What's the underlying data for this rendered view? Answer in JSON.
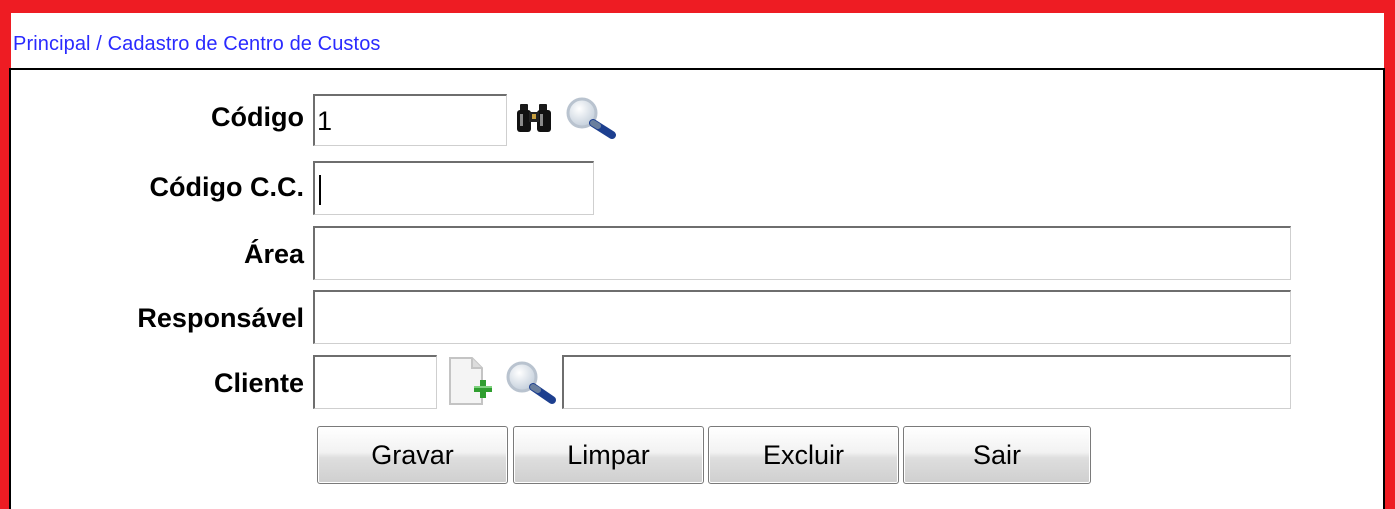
{
  "breadcrumb": "Principal / Cadastro de Centro de Custos",
  "form": {
    "codigo": {
      "label": "Código",
      "value": "1"
    },
    "codigo_cc": {
      "label": "Código C.C.",
      "value": ""
    },
    "area": {
      "label": "Área",
      "value": ""
    },
    "responsavel": {
      "label": "Responsável",
      "value": ""
    },
    "cliente": {
      "label": "Cliente",
      "code_value": "",
      "name_value": ""
    }
  },
  "icons": {
    "codigo_search": "binoculars-icon",
    "codigo_lookup": "magnifier-icon",
    "cliente_add": "add-document-icon",
    "cliente_lookup": "magnifier-icon"
  },
  "buttons": {
    "gravar": "Gravar",
    "limpar": "Limpar",
    "excluir": "Excluir",
    "sair": "Sair"
  },
  "colors": {
    "frame_border": "#ee1c23",
    "breadcrumb_text": "#2a2aff"
  }
}
